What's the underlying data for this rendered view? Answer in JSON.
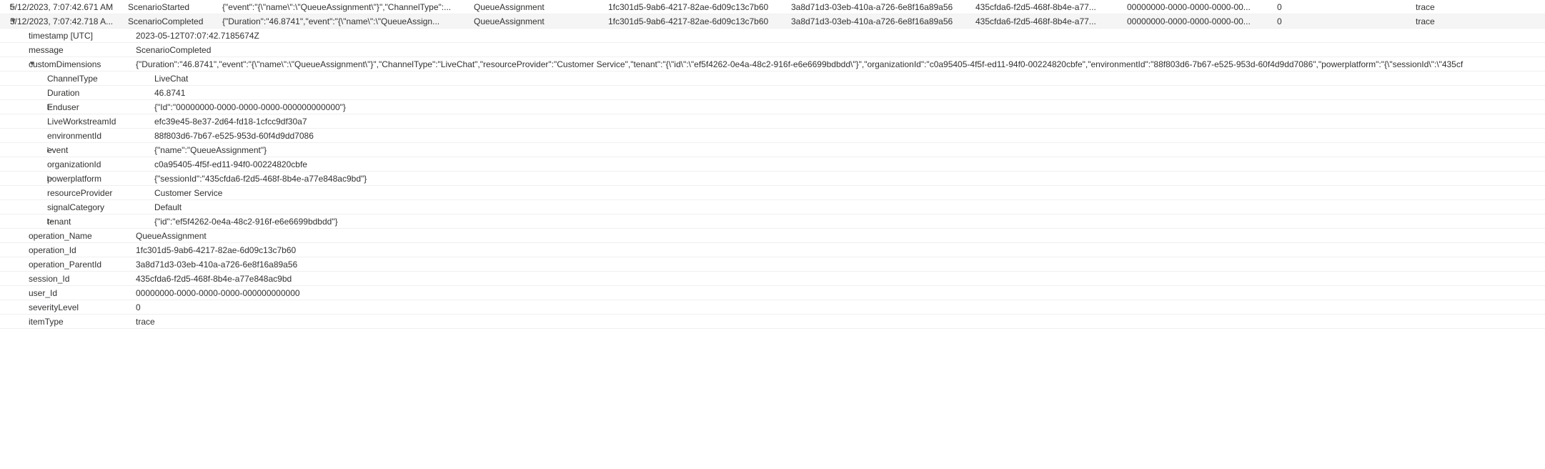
{
  "rows": [
    {
      "expanded": false,
      "ts": "5/12/2023, 7:07:42.671 AM",
      "message": "ScenarioStarted",
      "json": "{\"event\":\"{\\\"name\\\":\\\"QueueAssignment\\\"}\",\"ChannelType\":...",
      "opName": "QueueAssignment",
      "opId": "1fc301d5-9ab6-4217-82ae-6d09c13c7b60",
      "pid": "3a8d71d3-03eb-410a-a726-6e8f16a89a56",
      "sid": "435cfda6-f2d5-468f-8b4e-a77...",
      "uid": "00000000-0000-0000-0000-00...",
      "sev": "0",
      "type": "trace"
    },
    {
      "expanded": true,
      "ts": "5/12/2023, 7:07:42.718 A...",
      "message": "ScenarioCompleted",
      "json": "{\"Duration\":\"46.8741\",\"event\":\"{\\\"name\\\":\\\"QueueAssign...",
      "opName": "QueueAssignment",
      "opId": "1fc301d5-9ab6-4217-82ae-6d09c13c7b60",
      "pid": "3a8d71d3-03eb-410a-a726-6e8f16a89a56",
      "sid": "435cfda6-f2d5-468f-8b4e-a77...",
      "uid": "00000000-0000-0000-0000-00...",
      "sev": "0",
      "type": "trace"
    }
  ],
  "details": {
    "timestamp_label": "timestamp [UTC]",
    "timestamp_value": "2023-05-12T07:07:42.7185674Z",
    "message_label": "message",
    "message_value": "ScenarioCompleted",
    "customDimensions_label": "customDimensions",
    "customDimensions_value": "{\"Duration\":\"46.8741\",\"event\":\"{\\\"name\\\":\\\"QueueAssignment\\\"}\",\"ChannelType\":\"LiveChat\",\"resourceProvider\":\"Customer Service\",\"tenant\":\"{\\\"id\\\":\\\"ef5f4262-0e4a-48c2-916f-e6e6699bdbdd\\\"}\",\"organizationId\":\"c0a95405-4f5f-ed11-94f0-00224820cbfe\",\"environmentId\":\"88f803d6-7b67-e525-953d-60f4d9dd7086\",\"powerplatform\":\"{\\\"sessionId\\\":\\\"435cf",
    "cd": {
      "ChannelType": {
        "label": "ChannelType",
        "value": "LiveChat"
      },
      "Duration": {
        "label": "Duration",
        "value": "46.8741"
      },
      "Enduser": {
        "label": "Enduser",
        "value": "{\"Id\":\"00000000-0000-0000-0000-000000000000\"}"
      },
      "LiveWorkstreamId": {
        "label": "LiveWorkstreamId",
        "value": "efc39e45-8e37-2d64-fd18-1cfcc9df30a7"
      },
      "environmentId": {
        "label": "environmentId",
        "value": "88f803d6-7b67-e525-953d-60f4d9dd7086"
      },
      "event": {
        "label": "event",
        "value": "{\"name\":\"QueueAssignment\"}"
      },
      "organizationId": {
        "label": "organizationId",
        "value": "c0a95405-4f5f-ed11-94f0-00224820cbfe"
      },
      "powerplatform": {
        "label": "powerplatform",
        "value": "{\"sessionId\":\"435cfda6-f2d5-468f-8b4e-a77e848ac9bd\"}"
      },
      "resourceProvider": {
        "label": "resourceProvider",
        "value": "Customer Service"
      },
      "signalCategory": {
        "label": "signalCategory",
        "value": "Default"
      },
      "tenant": {
        "label": "tenant",
        "value": "{\"id\":\"ef5f4262-0e4a-48c2-916f-e6e6699bdbdd\"}"
      }
    },
    "tail": {
      "operation_Name": {
        "label": "operation_Name",
        "value": "QueueAssignment"
      },
      "operation_Id": {
        "label": "operation_Id",
        "value": "1fc301d5-9ab6-4217-82ae-6d09c13c7b60"
      },
      "operation_ParentId": {
        "label": "operation_ParentId",
        "value": "3a8d71d3-03eb-410a-a726-6e8f16a89a56"
      },
      "session_Id": {
        "label": "session_Id",
        "value": "435cfda6-f2d5-468f-8b4e-a77e848ac9bd"
      },
      "user_Id": {
        "label": "user_Id",
        "value": "00000000-0000-0000-0000-000000000000"
      },
      "severityLevel": {
        "label": "severityLevel",
        "value": "0"
      },
      "itemType": {
        "label": "itemType",
        "value": "trace"
      }
    }
  }
}
